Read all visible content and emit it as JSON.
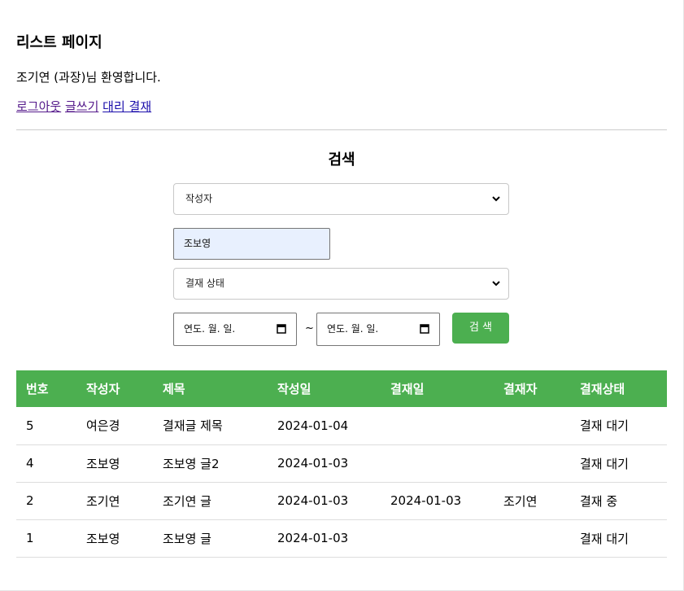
{
  "header": {
    "title": "리스트 페이지",
    "welcome": "조기연 (과장)님 환영합니다.",
    "links": {
      "logout": "로그아웃",
      "write": "글쓰기",
      "proxy": "대리 결재"
    }
  },
  "search": {
    "title": "검색",
    "field_select": "작성자",
    "keyword_value": "조보영",
    "status_select": "결재 상태",
    "date_from_placeholder": "연도. 월. 일.",
    "date_to_placeholder": "연도. 월. 일.",
    "range_separator": "~",
    "button_label": "검 색"
  },
  "colors": {
    "accent": "#4caf50",
    "link": "#1a0dab",
    "visited_link": "#551a8b"
  },
  "table": {
    "headers": [
      "번호",
      "작성자",
      "제목",
      "작성일",
      "결재일",
      "결재자",
      "결재상태"
    ],
    "rows": [
      [
        "5",
        "여은경",
        "결재글 제목",
        "2024-01-04",
        "",
        "",
        "결재 대기"
      ],
      [
        "4",
        "조보영",
        "조보영 글2",
        "2024-01-03",
        "",
        "",
        "결재 대기"
      ],
      [
        "2",
        "조기연",
        "조기연 글",
        "2024-01-03",
        "2024-01-03",
        "조기연",
        "결재 중"
      ],
      [
        "1",
        "조보영",
        "조보영 글",
        "2024-01-03",
        "",
        "",
        "결재 대기"
      ]
    ]
  }
}
